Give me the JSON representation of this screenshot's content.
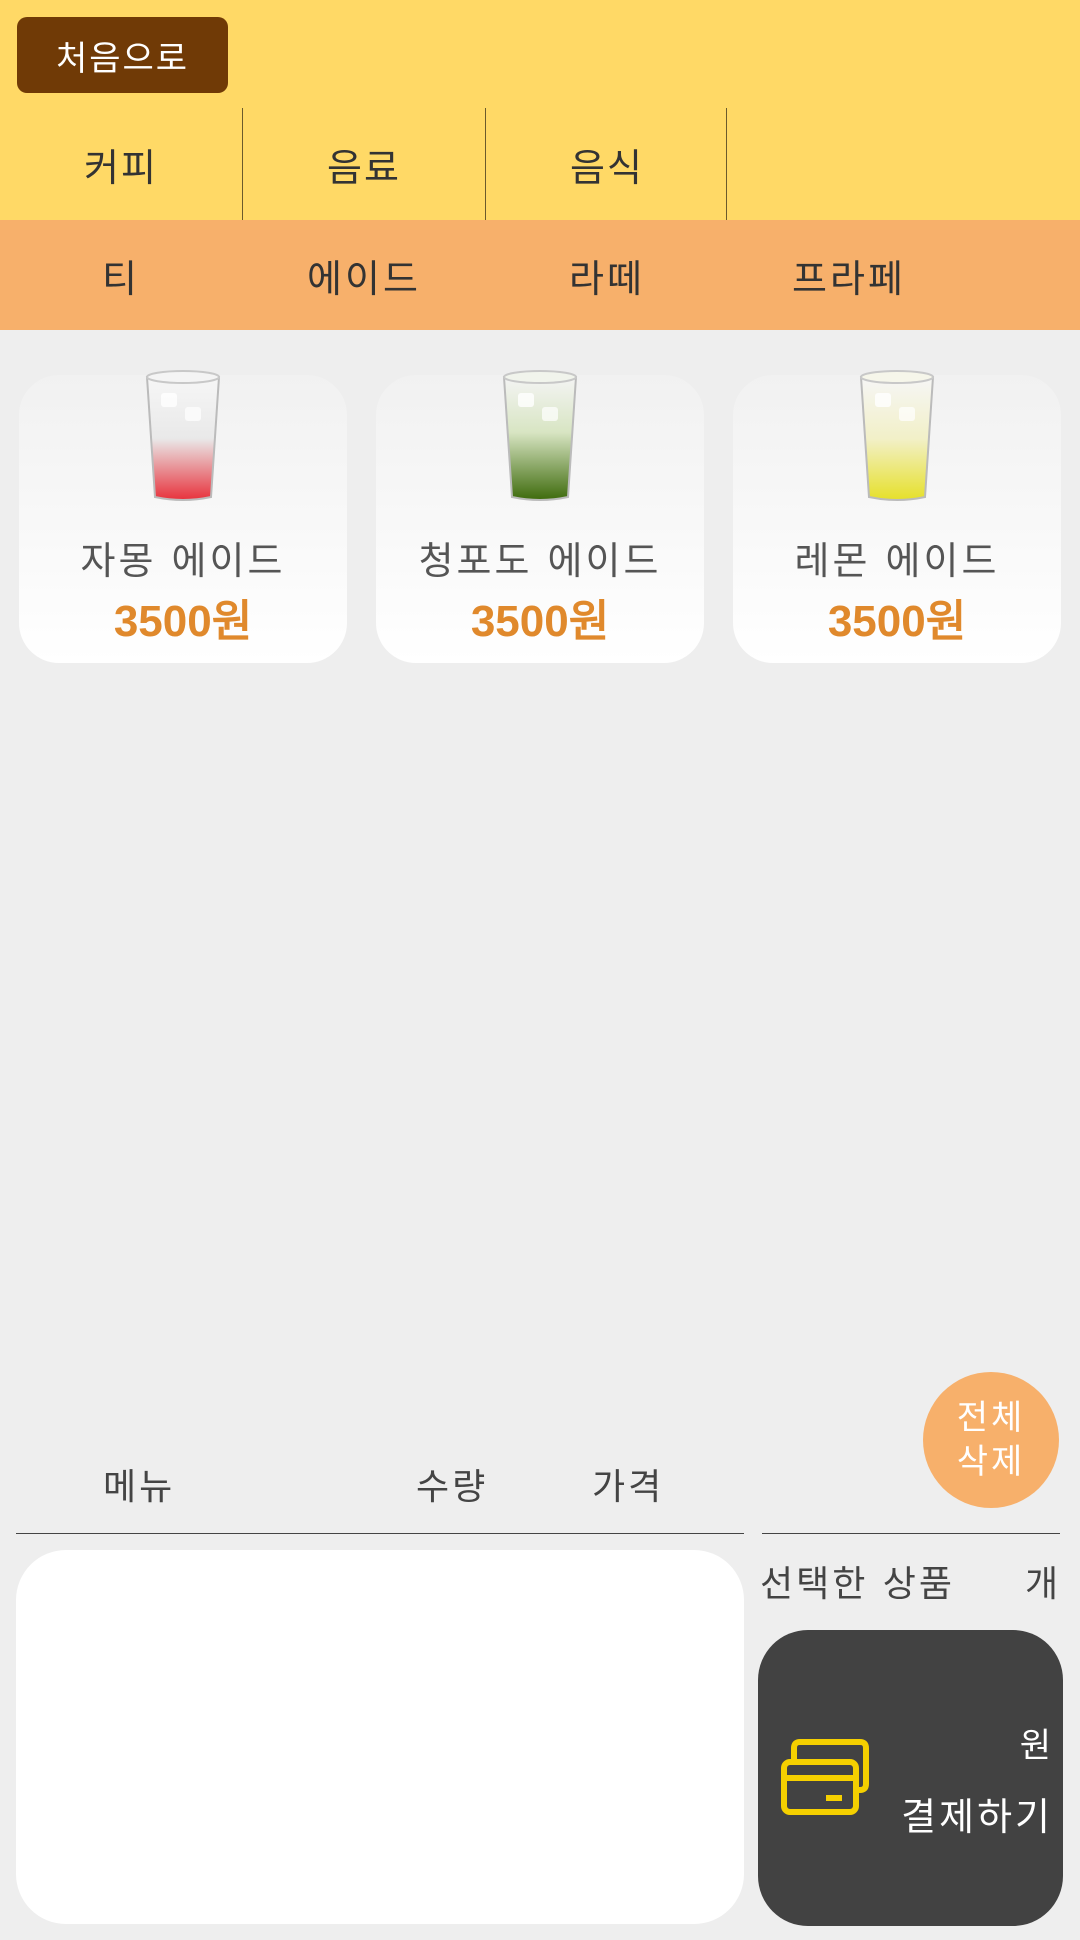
{
  "header": {
    "home_label": "처음으로",
    "categories": [
      "커피",
      "음료",
      "음식"
    ]
  },
  "subcategories": [
    "티",
    "에이드",
    "라떼",
    "프라페"
  ],
  "products": [
    {
      "name": "자몽 에이드",
      "price": "3500원",
      "color": "#e8323c"
    },
    {
      "name": "청포도 에이드",
      "price": "3500원",
      "color": "#4e7a12"
    },
    {
      "name": "레몬 에이드",
      "price": "3500원",
      "color": "#e8e23a"
    }
  ],
  "cart": {
    "clear_label_line1": "전체",
    "clear_label_line2": "삭제",
    "columns": [
      "메뉴",
      "수량",
      "가격"
    ],
    "selected_label": "선택한 상품",
    "count_unit": "개",
    "total_unit": "원",
    "pay_label": "결제하기",
    "pay_icon": "credit-card-icon"
  },
  "colors": {
    "header_bg": "#ffd966",
    "subtab_bg": "#f7b06b",
    "home_btn_bg": "#703a06",
    "price": "#e0892c",
    "pay_btn_bg": "#424242",
    "pay_icon": "#f5d000"
  }
}
